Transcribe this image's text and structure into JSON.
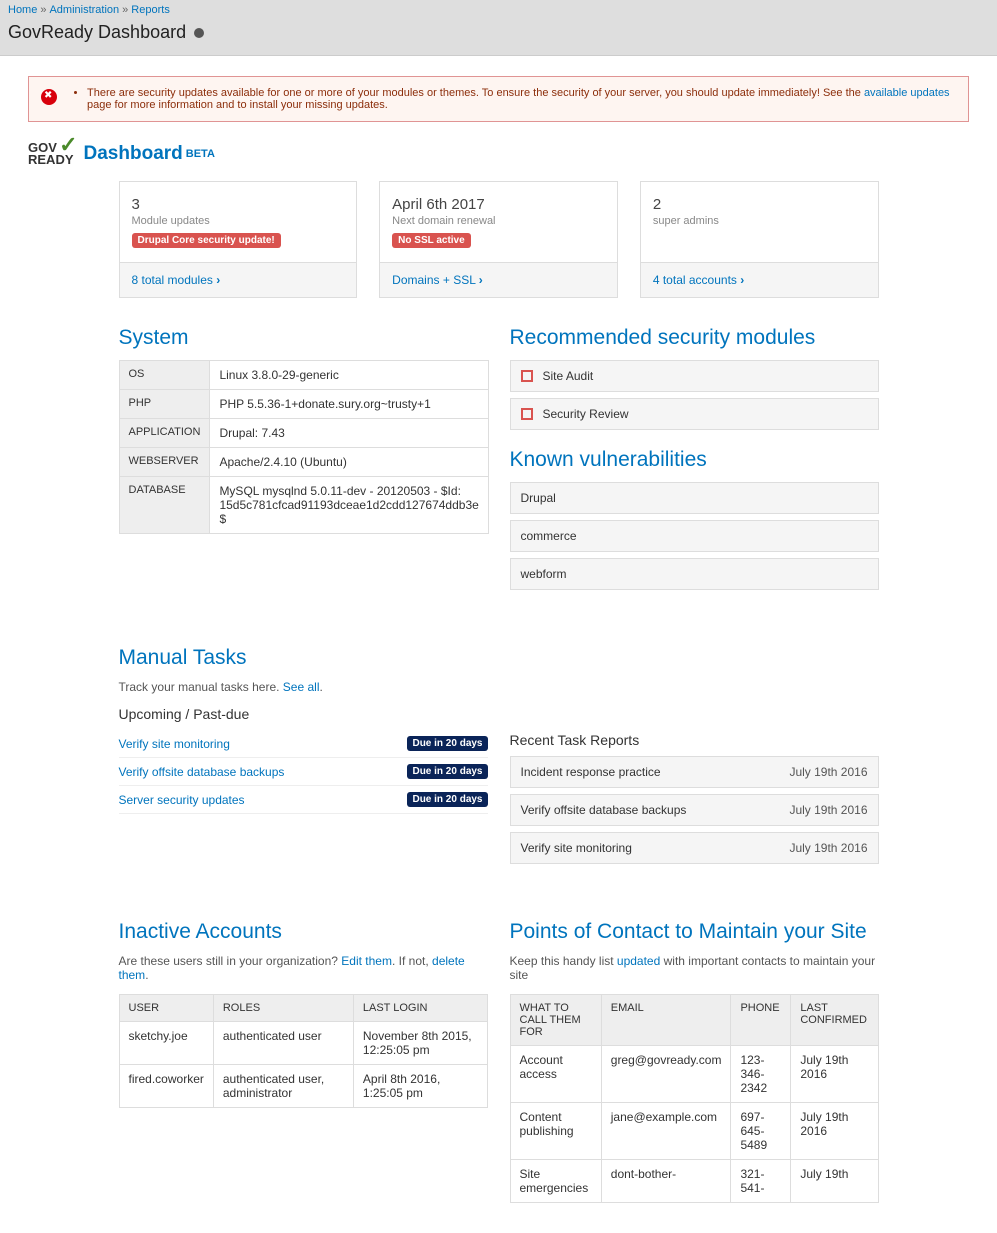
{
  "breadcrumb": {
    "home": "Home",
    "admin": "Administration",
    "reports": "Reports"
  },
  "page_title": "GovReady Dashboard",
  "alert": {
    "text_before": "There are security updates available for one or more of your modules or themes. To ensure the security of your server, you should update immediately! See the ",
    "link": "available updates",
    "text_after": " page for more information and to install your missing updates."
  },
  "brand": {
    "logo_top": "GOV",
    "logo_bot": "READY",
    "title": "Dashboard",
    "beta": "BETA"
  },
  "card_modules": {
    "value": "3",
    "label": "Module updates",
    "badge": "Drupal Core security update!",
    "foot": "8 total modules"
  },
  "card_domain": {
    "value": "April 6th 2017",
    "label": "Next domain renewal",
    "badge": "No SSL active",
    "foot": "Domains + SSL"
  },
  "card_accounts": {
    "value": "2",
    "label": "super admins",
    "foot": "4 total accounts"
  },
  "system": {
    "heading": "System",
    "rows": [
      {
        "k": "OS",
        "v": "Linux 3.8.0-29-generic"
      },
      {
        "k": "PHP",
        "v": "PHP 5.5.36-1+donate.sury.org~trusty+1"
      },
      {
        "k": "APPLICATION",
        "v": "Drupal: 7.43"
      },
      {
        "k": "WEBSERVER",
        "v": "Apache/2.4.10 (Ubuntu)"
      },
      {
        "k": "DATABASE",
        "v": "MySQL mysqlnd 5.0.11-dev - 20120503 - $Id: 15d5c781cfcad91193dceae1d2cdd127674ddb3e $"
      }
    ]
  },
  "rec_mods": {
    "heading": "Recommended security modules",
    "items": [
      "Site Audit",
      "Security Review"
    ]
  },
  "vulns": {
    "heading": "Known vulnerabilities",
    "items": [
      "Drupal",
      "commerce",
      "webform"
    ]
  },
  "manual": {
    "heading": "Manual Tasks",
    "sub_before": "Track your manual tasks here. ",
    "see_all": "See all",
    "upcoming": "Upcoming / Past-due",
    "tasks": [
      {
        "name": "Verify site monitoring",
        "due": "Due in 20 days"
      },
      {
        "name": "Verify offsite database backups",
        "due": "Due in 20 days"
      },
      {
        "name": "Server security updates",
        "due": "Due in 20 days"
      }
    ],
    "recent_h": "Recent Task Reports",
    "recent": [
      {
        "name": "Incident response practice",
        "date": "July 19th 2016"
      },
      {
        "name": "Verify offsite database backups",
        "date": "July 19th 2016"
      },
      {
        "name": "Verify site monitoring",
        "date": "July 19th 2016"
      }
    ]
  },
  "inactive": {
    "heading": "Inactive Accounts",
    "sub_a": "Are these users still in your organization? ",
    "edit": "Edit them",
    "sub_b": ". If not, ",
    "delete": "delete them",
    "headers": {
      "user": "USER",
      "roles": "ROLES",
      "last": "LAST LOGIN"
    },
    "rows": [
      {
        "user": "sketchy.joe",
        "roles": "authenticated user",
        "last": "November 8th 2015, 12:25:05 pm"
      },
      {
        "user": "fired.coworker",
        "roles": "authenticated user, administrator",
        "last": "April 8th 2016, 1:25:05 pm"
      }
    ]
  },
  "poc": {
    "heading": "Points of Contact to Maintain your Site",
    "sub_a": "Keep this handy list ",
    "updated": "updated",
    "sub_b": " with important contacts to maintain your site",
    "headers": {
      "what": "WHAT TO CALL THEM FOR",
      "email": "EMAIL",
      "phone": "PHONE",
      "last": "LAST CONFIRMED"
    },
    "rows": [
      {
        "what": "Account access",
        "email": "greg@govready.com",
        "phone": "123-346-2342",
        "last": "July 19th 2016"
      },
      {
        "what": "Content publishing",
        "email": "jane@example.com",
        "phone": "697-645-5489",
        "last": "July 19th 2016"
      },
      {
        "what": "Site emergencies",
        "email": "dont-bother-",
        "phone": "321-541-",
        "last": "July 19th"
      }
    ]
  }
}
